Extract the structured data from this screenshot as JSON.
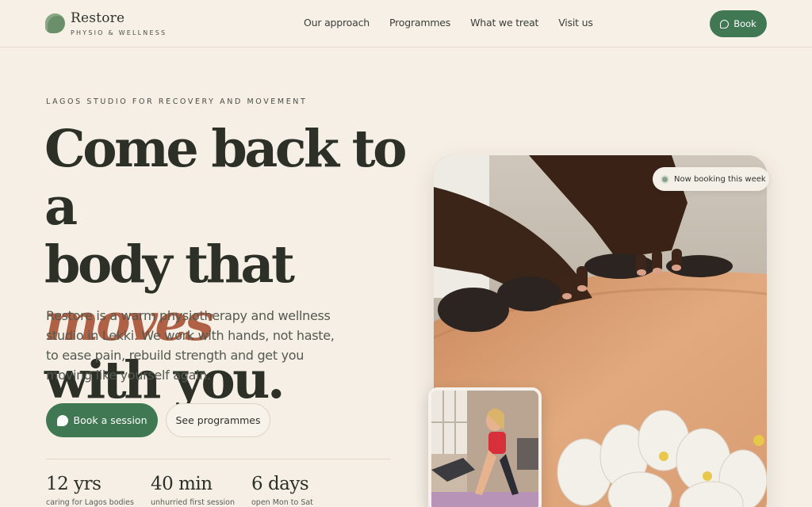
{
  "brand": {
    "name": "Restore",
    "tagline": "PHYSIO & WELLNESS"
  },
  "nav": {
    "items": [
      "Our approach",
      "Programmes",
      "What we treat",
      "Visit us"
    ],
    "book_label": "Book"
  },
  "hero": {
    "eyebrow": "LAGOS STUDIO FOR RECOVERY AND MOVEMENT",
    "headline_line1": "Come back to a",
    "headline_line2_start": "body that ",
    "headline_accent": "moves",
    "headline_line3": "with you.",
    "lead": "Restore is a warm physiotherapy and wellness studio in Lekki. We work with hands, not haste, to ease pain, rebuild strength and get you moving like yourself again.",
    "primary_cta": "Book a session",
    "secondary_cta": "See programmes",
    "badge": "Now booking this week"
  },
  "stats": [
    {
      "value": "12 yrs",
      "label": "caring for Lagos bodies"
    },
    {
      "value": "40 min",
      "label": "unhurried first session"
    },
    {
      "value": "6 days",
      "label": "open Mon to Sat"
    }
  ],
  "colors": {
    "background": "#f5efe6",
    "accent_green": "#3f7852",
    "accent_terracotta": "#b06044",
    "text_dark": "#2c3026"
  },
  "icons": {
    "logo": "leaf-bubble-icon",
    "book": "chat-bubble-icon",
    "badge": "status-dot-icon"
  }
}
